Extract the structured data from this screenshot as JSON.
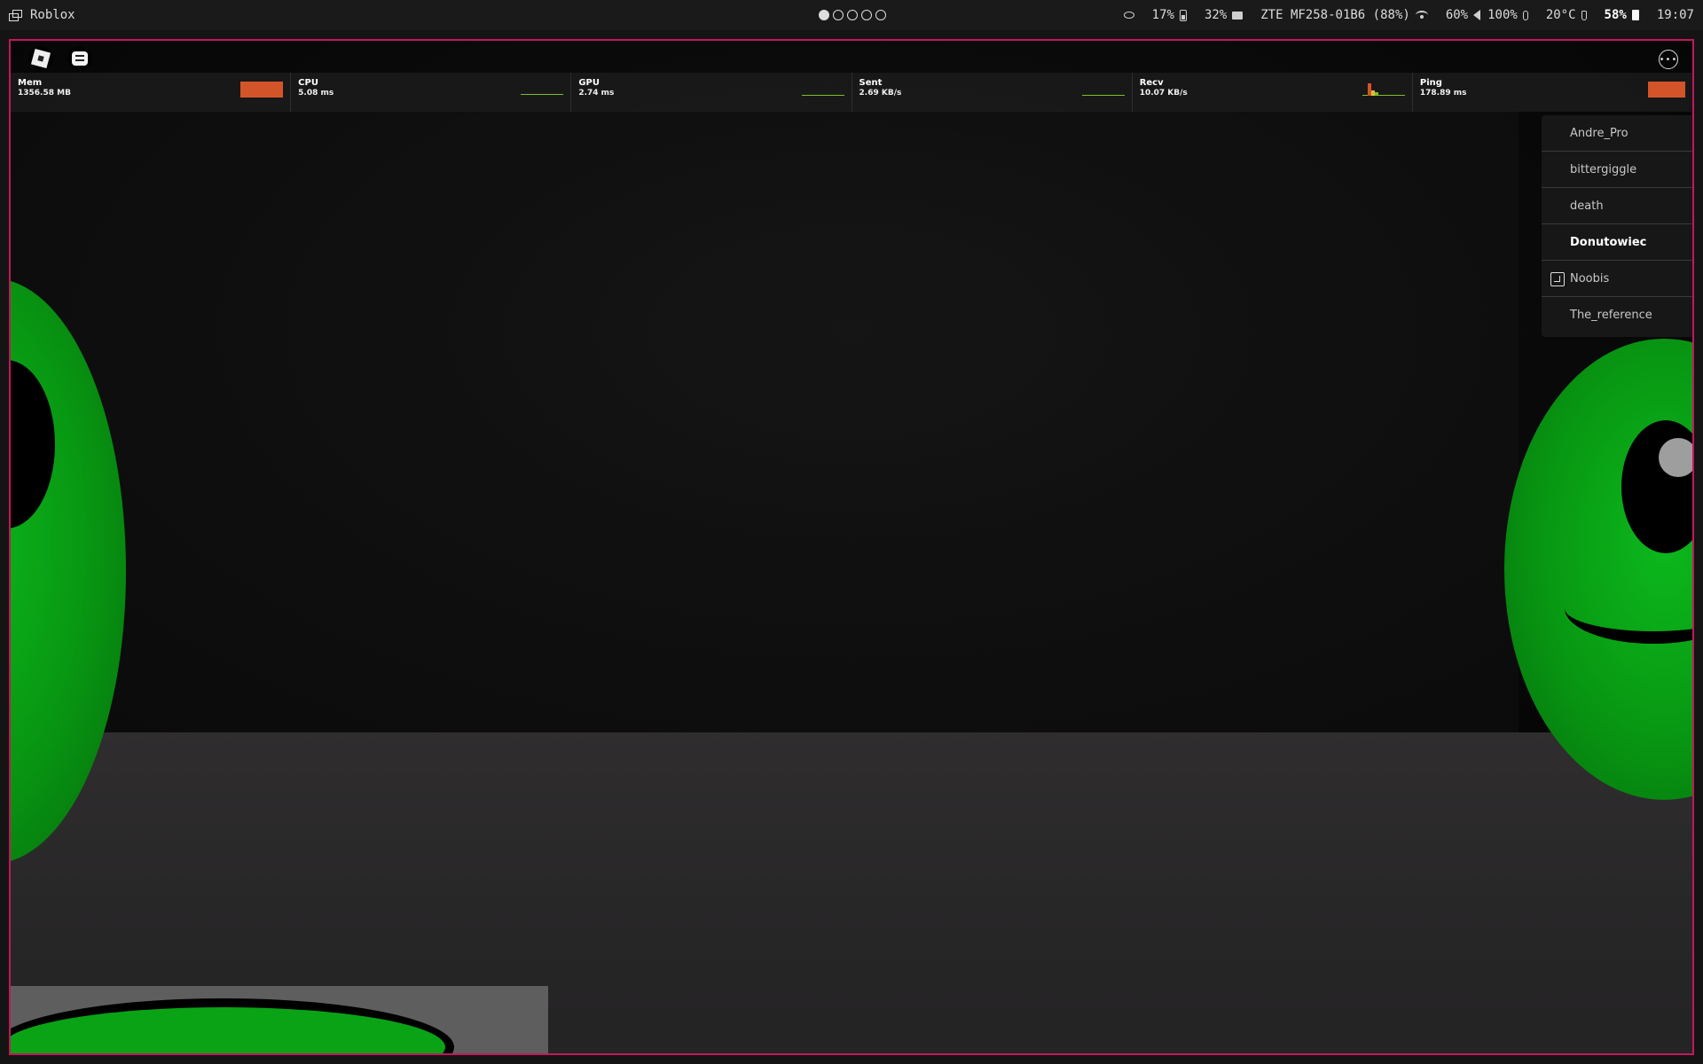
{
  "system_bar": {
    "app_name": "Roblox",
    "workspaces": [
      true,
      false,
      false,
      false,
      false
    ],
    "eye_icon": "eye-slash-icon",
    "battery_level": "17%",
    "memory_usage": "32%",
    "network_name": "ZTE MF258-01B6 (88%)",
    "brightness": "60%",
    "volume": "100%",
    "temperature": "20°C",
    "charge": "58%",
    "time": "19:07"
  },
  "perf_stats": [
    {
      "label": "Mem",
      "value": "1356.58 MB"
    },
    {
      "label": "CPU",
      "value": "5.08 ms"
    },
    {
      "label": "GPU",
      "value": "2.74 ms"
    },
    {
      "label": "Sent",
      "value": "2.69 KB/s"
    },
    {
      "label": "Recv",
      "value": "10.07 KB/s"
    },
    {
      "label": "Ping",
      "value": "178.89 ms"
    }
  ],
  "player_list": [
    {
      "name": "Andre_Pro"
    },
    {
      "name": "bittergiggle"
    },
    {
      "name": "death"
    },
    {
      "name": "Donutowiec"
    },
    {
      "name": "Noobis"
    },
    {
      "name": "The_reference"
    }
  ],
  "colors": {
    "window_border": "#c2185b",
    "perf_alert": "#d4542a",
    "perf_graph": "#7bbf2a",
    "character_green": "#089612"
  }
}
